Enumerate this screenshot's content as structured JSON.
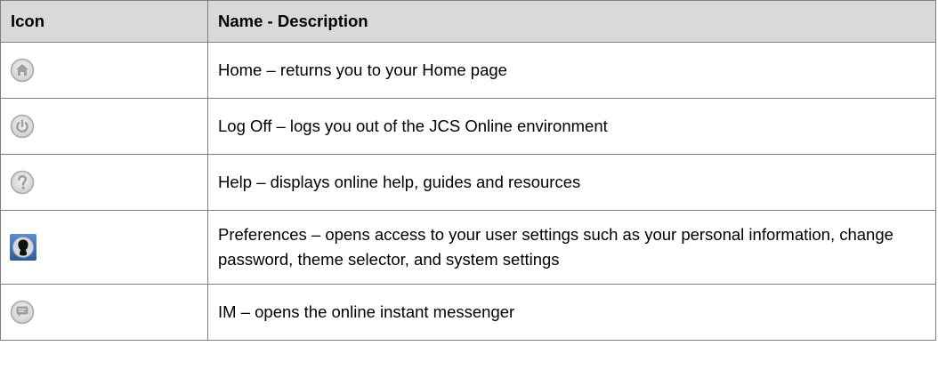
{
  "header": {
    "icon_col": "Icon",
    "desc_col": "Name - Description"
  },
  "rows": [
    {
      "icon": "home-icon",
      "description": "Home – returns you to your Home page"
    },
    {
      "icon": "power-icon",
      "description": "Log Off – logs you out of the JCS Online environment"
    },
    {
      "icon": "help-icon",
      "description": "Help – displays online help, guides and resources"
    },
    {
      "icon": "user-silhouette-icon",
      "description": "Preferences – opens access to your user settings such as your personal information, change password, theme selector, and system settings"
    },
    {
      "icon": "chat-bubble-icon",
      "description": "IM – opens the online instant messenger"
    }
  ],
  "colors": {
    "header_bg": "#d9d9d9",
    "border": "#7f7f7f",
    "icon_gray": "#bfbfbf",
    "pref_blue": "#3a6aa8"
  }
}
